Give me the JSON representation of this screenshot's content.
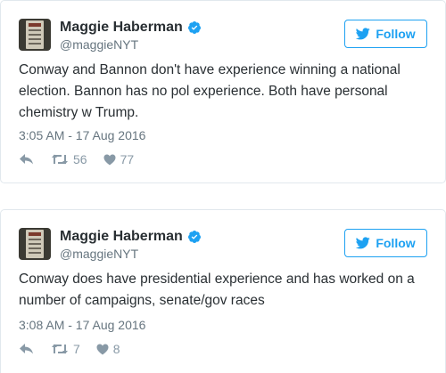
{
  "tweets": [
    {
      "name": "Maggie Haberman",
      "handle": "@maggieNYT",
      "follow_label": "Follow",
      "text": "Conway and Bannon don't have experience winning a national election. Bannon has no pol experience. Both have personal chemistry w Trump.",
      "timestamp": "3:05 AM - 17 Aug 2016",
      "retweets": "56",
      "likes": "77"
    },
    {
      "name": "Maggie Haberman",
      "handle": "@maggieNYT",
      "follow_label": "Follow",
      "text": "Conway does have presidential experience and has worked on a number of campaigns, senate/gov races",
      "timestamp": "3:08 AM - 17 Aug 2016",
      "retweets": "7",
      "likes": "8"
    }
  ],
  "colors": {
    "accent": "#1da1f2",
    "text": "#292f33",
    "muted": "#66757f",
    "icon": "#8899a6",
    "border": "#e1e8ed"
  },
  "icons": [
    "verified-badge-icon",
    "twitter-bird-icon",
    "reply-icon",
    "retweet-icon",
    "heart-icon"
  ]
}
